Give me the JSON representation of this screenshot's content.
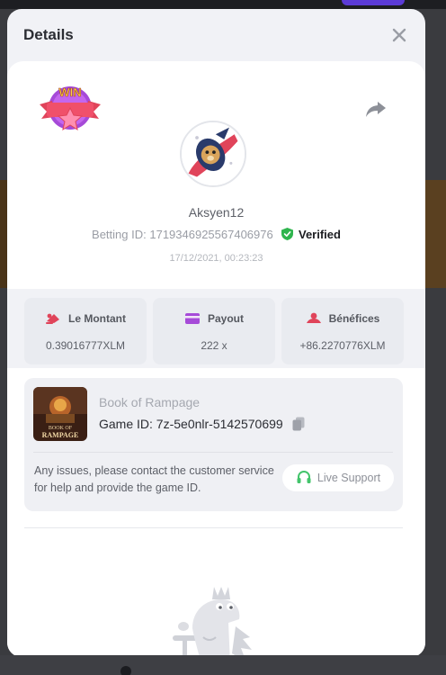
{
  "modal": {
    "title": "Details"
  },
  "icons": {
    "close": "close-icon",
    "share": "share-icon",
    "badge": "win-badge-icon",
    "verified": "shield-check-icon",
    "copy": "copy-icon",
    "support": "headset-icon"
  },
  "badge": {
    "text": "WIN"
  },
  "user": {
    "name": "Aksyen12",
    "betting_label": "Betting ID:",
    "betting_id": "1719346925567406976",
    "verified_label": "Verified",
    "timestamp": "17/12/2021, 00:23:23"
  },
  "stats": [
    {
      "label": "Le Montant",
      "value": "0.39016777XLM",
      "icon": "coins-icon"
    },
    {
      "label": "Payout",
      "value": "222 x",
      "icon": "card-icon"
    },
    {
      "label": "Bénéfices",
      "value": "+86.2270776XLM",
      "icon": "profit-icon"
    }
  ],
  "game": {
    "name": "Book of Rampage",
    "id_label": "Game ID:",
    "id": "7z-5e0nlr-5142570699",
    "thumb_line1": "BOOK OF",
    "thumb_line2": "RAMPAGE"
  },
  "support": {
    "message": "Any issues, please contact the customer service for help and provide the game ID.",
    "button": "Live Support"
  },
  "colors": {
    "accent_green": "#43c46b",
    "accent_red": "#e0445a",
    "accent_purple": "#8f3fd6",
    "verified_green": "#2fb54e"
  }
}
